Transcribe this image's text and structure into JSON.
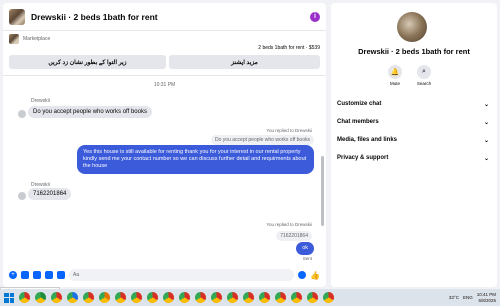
{
  "header": {
    "title": "Drewskii · 2 beds 1bath for rent"
  },
  "marketplace": {
    "label": "Marketplace",
    "listing": "2 beds 1bath for rent · $539",
    "btn_right": "مزید اپشنز",
    "btn_left": "زیر التوا کے بطور نشان زد کریں"
  },
  "messages": {
    "timestamp": "10:31 PM",
    "incoming1": {
      "sender": "Drewskii",
      "text": "Do you accept people who works off books"
    },
    "reply_note": "You replied to Drewskii",
    "quote": "Do you accept people who works off books",
    "outgoing": "Yes this house is still available for renting thank you for your interest in our rental property kindly send me your contact number so we can discuss further detail and requirments about the house",
    "incoming2": {
      "sender": "Drewskii",
      "text": "7162201864"
    },
    "reply_note2": "You replied to Drewskii",
    "quote2": "7162201864",
    "ok": "ok",
    "sent": "Sent"
  },
  "composer": {
    "placeholder": "Aa"
  },
  "info": {
    "name": "Drewskii · 2 beds 1bath for rent",
    "mute": "Mute",
    "search": "Search",
    "sections": [
      "Customize chat",
      "Chat members",
      "Media, files and links",
      "Privacy & support"
    ]
  },
  "statusbar": "eralSurface=messenger_lig...",
  "taskbar": {
    "temp": "33°C",
    "lang": "ENG",
    "time": "10:41 PM",
    "date": "6/8/2025",
    "app_colors": [
      "#d93025",
      "#1e8e3e",
      "#d93025",
      "#1a73e8",
      "#d93025",
      "#e37400",
      "#d93025",
      "#d93025",
      "#d93025",
      "#d93025",
      "#d93025",
      "#d93025",
      "#d93025",
      "#d93025",
      "#d93025",
      "#d93025",
      "#d93025",
      "#d93025",
      "#d93025",
      "#d93025",
      "#d93025",
      "#d93025"
    ]
  },
  "colors": {
    "accent": "#0866ff",
    "outgoing_bubble": "#3b5bdb",
    "info_icon": "#9b2fc9"
  }
}
